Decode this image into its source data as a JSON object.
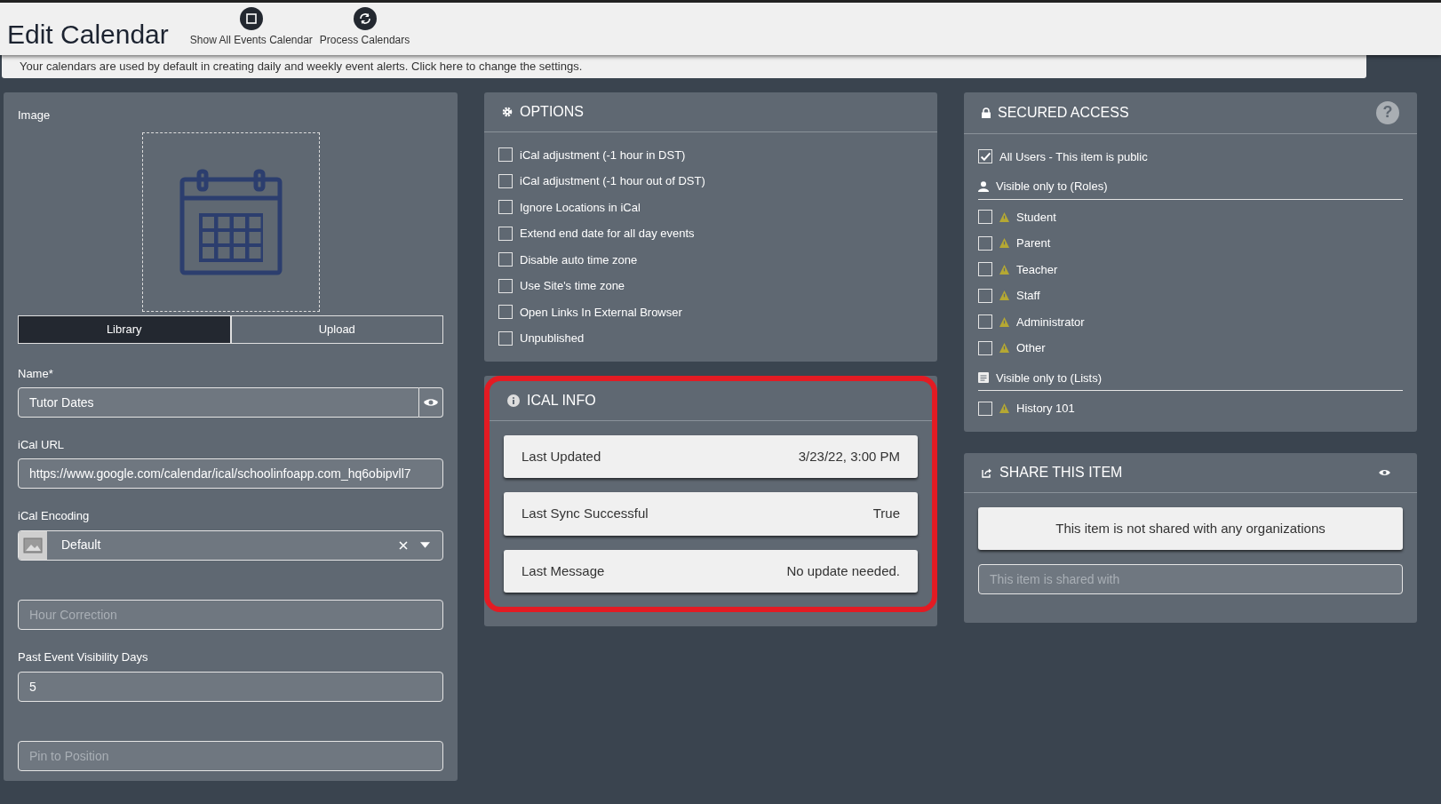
{
  "header": {
    "title": "Edit Calendar",
    "actions": [
      {
        "kind": "square",
        "label": "Show All Events Calendar"
      },
      {
        "kind": "refresh",
        "label": "Process Calendars"
      }
    ]
  },
  "notice": "Your calendars are used by default in creating daily and weekly event alerts. Click here to change the settings.",
  "image_panel": {
    "label": "Image",
    "tabs": [
      {
        "label": "Library",
        "selected": true
      },
      {
        "label": "Upload",
        "selected": false
      }
    ]
  },
  "fields": [
    {
      "kind": "text",
      "label": "Name*",
      "value": "Tutor Dates",
      "eye": true
    },
    {
      "kind": "text",
      "label": "iCal URL",
      "value": "https://www.google.com/calendar/ical/schoolinfoapp.com_hq6obipvll7"
    },
    {
      "kind": "select",
      "label": "iCal Encoding",
      "value": "Default"
    },
    {
      "kind": "text",
      "placeholder": "Hour Correction"
    },
    {
      "kind": "text",
      "label": "Past Event Visibility Days",
      "value": "5"
    },
    {
      "kind": "text",
      "placeholder": "Pin to Position"
    }
  ],
  "options": {
    "title": "OPTIONS",
    "items": [
      {
        "label": "iCal adjustment (-1 hour in DST)",
        "checked": false
      },
      {
        "label": "iCal adjustment (-1 hour out of DST)",
        "checked": false
      },
      {
        "label": "Ignore Locations in iCal",
        "checked": false
      },
      {
        "label": "Extend end date for all day events",
        "checked": false
      },
      {
        "label": "Disable auto time zone",
        "checked": false
      },
      {
        "label": "Use Site's time zone",
        "checked": false
      },
      {
        "label": "Open Links In External Browser",
        "checked": false
      },
      {
        "label": "Unpublished",
        "checked": false
      }
    ]
  },
  "ical_info": {
    "title": "ICAL INFO",
    "highlighted": true,
    "rows": [
      {
        "label": "Last Updated",
        "value": "3/23/22, 3:00 PM"
      },
      {
        "label": "Last Sync Successful",
        "value": "True"
      },
      {
        "label": "Last Message",
        "value": "No update needed."
      }
    ]
  },
  "secured_access": {
    "title": "SECURED ACCESS",
    "help": "?",
    "public": {
      "label": "All Users - This item is public",
      "checked": true
    },
    "groups": [
      {
        "kind": "roles",
        "title": "Visible only to (Roles)",
        "items": [
          {
            "label": "Student",
            "checked": false
          },
          {
            "label": "Parent",
            "checked": false
          },
          {
            "label": "Teacher",
            "checked": false
          },
          {
            "label": "Staff",
            "checked": false
          },
          {
            "label": "Administrator",
            "checked": false
          },
          {
            "label": "Other",
            "checked": false
          }
        ]
      },
      {
        "kind": "lists",
        "title": "Visible only to (Lists)",
        "items": [
          {
            "label": "History 101",
            "checked": false
          }
        ]
      }
    ]
  },
  "share": {
    "title": "SHARE THIS ITEM",
    "message": "This item is not shared with any organizations",
    "placeholder": "This item is shared with"
  }
}
